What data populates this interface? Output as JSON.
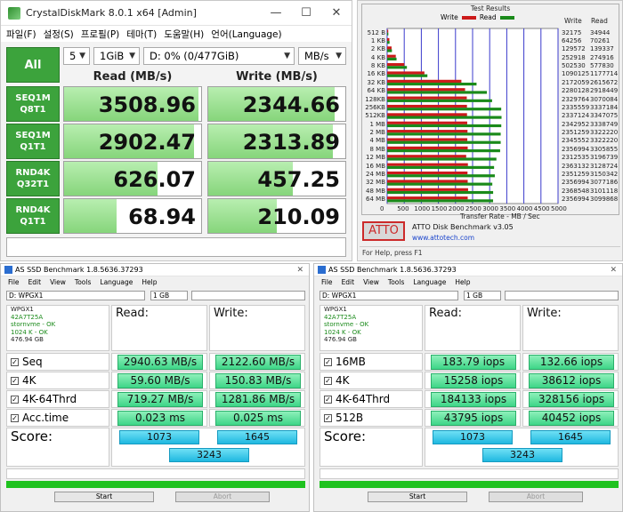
{
  "cdm": {
    "title": "CrystalDiskMark 8.0.1 x64 [Admin]",
    "win_min": "—",
    "win_max": "☐",
    "win_close": "✕",
    "menu": [
      "파일(F)",
      "설정(S)",
      "프로필(P)",
      "테마(T)",
      "도움말(H)",
      "언어(Language)"
    ],
    "all_label": "All",
    "count": "5",
    "size": "1GiB",
    "drive": "D: 0% (0/477GiB)",
    "unit": "MB/s",
    "read_header": "Read (MB/s)",
    "write_header": "Write (MB/s)",
    "rows": [
      {
        "l1": "SEQ1M",
        "l2": "Q8T1",
        "read": "3508.96",
        "write": "2344.66",
        "read_fill": 0.98,
        "write_fill": 0.92
      },
      {
        "l1": "SEQ1M",
        "l2": "Q1T1",
        "read": "2902.47",
        "write": "2313.89",
        "read_fill": 0.95,
        "write_fill": 0.91
      },
      {
        "l1": "RND4K",
        "l2": "Q32T1",
        "read": "626.07",
        "write": "457.25",
        "read_fill": 0.68,
        "write_fill": 0.62
      },
      {
        "l1": "RND4K",
        "l2": "Q1T1",
        "read": "68.94",
        "write": "210.09",
        "read_fill": 0.38,
        "write_fill": 0.5
      }
    ],
    "accent": "#3ca33c"
  },
  "atto": {
    "results_title": "Test Results",
    "legend_write": "Write",
    "legend_read": "Read",
    "col_write": "Write",
    "col_read": "Read",
    "x_title": "Transfer Rate - MB / Sec",
    "product": "ATTO Disk Benchmark v3.05",
    "url": "www.attotech.com",
    "logo": "ATTO",
    "status": "For Help, press F1",
    "write_color": "#cc1a1a",
    "read_color": "#1a8a1a"
  },
  "chart_data": {
    "type": "bar",
    "title": "Test Results",
    "xlabel": "Transfer Rate - MB / Sec",
    "xlim": [
      0,
      5000
    ],
    "xticks": [
      "0",
      "500",
      "1000",
      "1500",
      "2000",
      "2500",
      "3000",
      "3500",
      "4000",
      "4500",
      "5000"
    ],
    "categories": [
      "512 B",
      "1 KB",
      "2 KB",
      "4 KB",
      "8 KB",
      "16 KB",
      "32 KB",
      "64 KB",
      "128KB",
      "256KB",
      "512KB",
      "1 MB",
      "2 MB",
      "4 MB",
      "8 MB",
      "12 MB",
      "16 MB",
      "24 MB",
      "32 MB",
      "48 MB",
      "64 MB"
    ],
    "series": [
      {
        "name": "Write",
        "values": [
          32175,
          64256,
          129572,
          252918,
          502530,
          1090125,
          2172059,
          2280128,
          2329764,
          2335559,
          2337124,
          2342952,
          2351259,
          2345552,
          2356994,
          2312535,
          2363132,
          2351259,
          2356994,
          2368548,
          2356994
        ]
      },
      {
        "name": "Read",
        "values": [
          34944,
          70261,
          139337,
          274916,
          577830,
          1177714,
          2615672,
          2918449,
          3070084,
          3337184,
          3347075,
          3338749,
          3322220,
          3322220,
          3305855,
          3196739,
          3128724,
          3150342,
          3077186,
          3101118,
          3099868
        ]
      }
    ]
  },
  "asssd": [
    {
      "title": "AS SSD Benchmark 1.8.5636.37293",
      "menu": [
        "File",
        "Edit",
        "View",
        "Tools",
        "Language",
        "Help"
      ],
      "drive": "D: WPGX1",
      "size": "1 GB",
      "info": [
        "WPGX1",
        "42A7T25A",
        "stornvme - OK",
        "1024 K - OK",
        "476.94 GB"
      ],
      "read_header": "Read:",
      "write_header": "Write:",
      "rows": [
        {
          "label": "Seq",
          "read": "2940.63 MB/s",
          "write": "2122.60 MB/s"
        },
        {
          "label": "4K",
          "read": "59.60 MB/s",
          "write": "150.83 MB/s"
        },
        {
          "label": "4K-64Thrd",
          "read": "719.27 MB/s",
          "write": "1281.86 MB/s"
        },
        {
          "label": "Acc.time",
          "read": "0.023 ms",
          "write": "0.025 ms"
        }
      ],
      "score_label": "Score:",
      "score_read": "1073",
      "score_write": "1645",
      "score_total": "3243",
      "start": "Start",
      "abort": "Abort"
    },
    {
      "title": "AS SSD Benchmark 1.8.5636.37293",
      "menu": [
        "File",
        "Edit",
        "View",
        "Tools",
        "Language",
        "Help"
      ],
      "drive": "D: WPGX1",
      "size": "1 GB",
      "info": [
        "WPGX1",
        "42A7T25A",
        "stornvme - OK",
        "1024 K - OK",
        "476.94 GB"
      ],
      "read_header": "Read:",
      "write_header": "Write:",
      "rows": [
        {
          "label": "16MB",
          "read": "183.79 iops",
          "write": "132.66 iops"
        },
        {
          "label": "4K",
          "read": "15258 iops",
          "write": "38612 iops"
        },
        {
          "label": "4K-64Thrd",
          "read": "184133 iops",
          "write": "328156 iops"
        },
        {
          "label": "512B",
          "read": "43795 iops",
          "write": "40452 iops"
        }
      ],
      "score_label": "Score:",
      "score_read": "1073",
      "score_write": "1645",
      "score_total": "3243",
      "start": "Start",
      "abort": "Abort"
    }
  ]
}
